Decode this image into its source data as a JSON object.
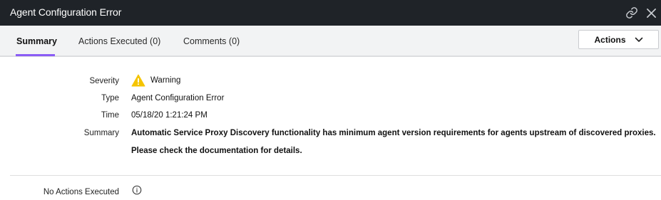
{
  "window": {
    "title": "Agent Configuration Error",
    "icons": {
      "link": "link-icon",
      "close": "close-icon"
    }
  },
  "tabs": [
    {
      "label": "Summary",
      "active": true
    },
    {
      "label": "Actions Executed (0)",
      "active": false
    },
    {
      "label": "Comments (0)",
      "active": false
    }
  ],
  "actions_button": {
    "label": "Actions",
    "icon": "chevron-down-icon"
  },
  "details": {
    "severity_label": "Severity",
    "severity_value": "Warning",
    "severity_icon": "warning-icon",
    "type_label": "Type",
    "type_value": "Agent Configuration Error",
    "time_label": "Time",
    "time_value": "05/18/20 1:21:24 PM",
    "summary_label": "Summary",
    "summary_line1": "Automatic Service Proxy Discovery functionality has minimum agent version requirements for agents upstream of discovered proxies.",
    "summary_line2": "Please check the documentation for details."
  },
  "footer": {
    "no_actions_label": "No Actions Executed",
    "icon": "info-icon"
  },
  "colors": {
    "titlebar": "#1f2328",
    "accent": "#8a5cf5",
    "warning": "#f5c400",
    "tabbar": "#f2f3f4"
  }
}
